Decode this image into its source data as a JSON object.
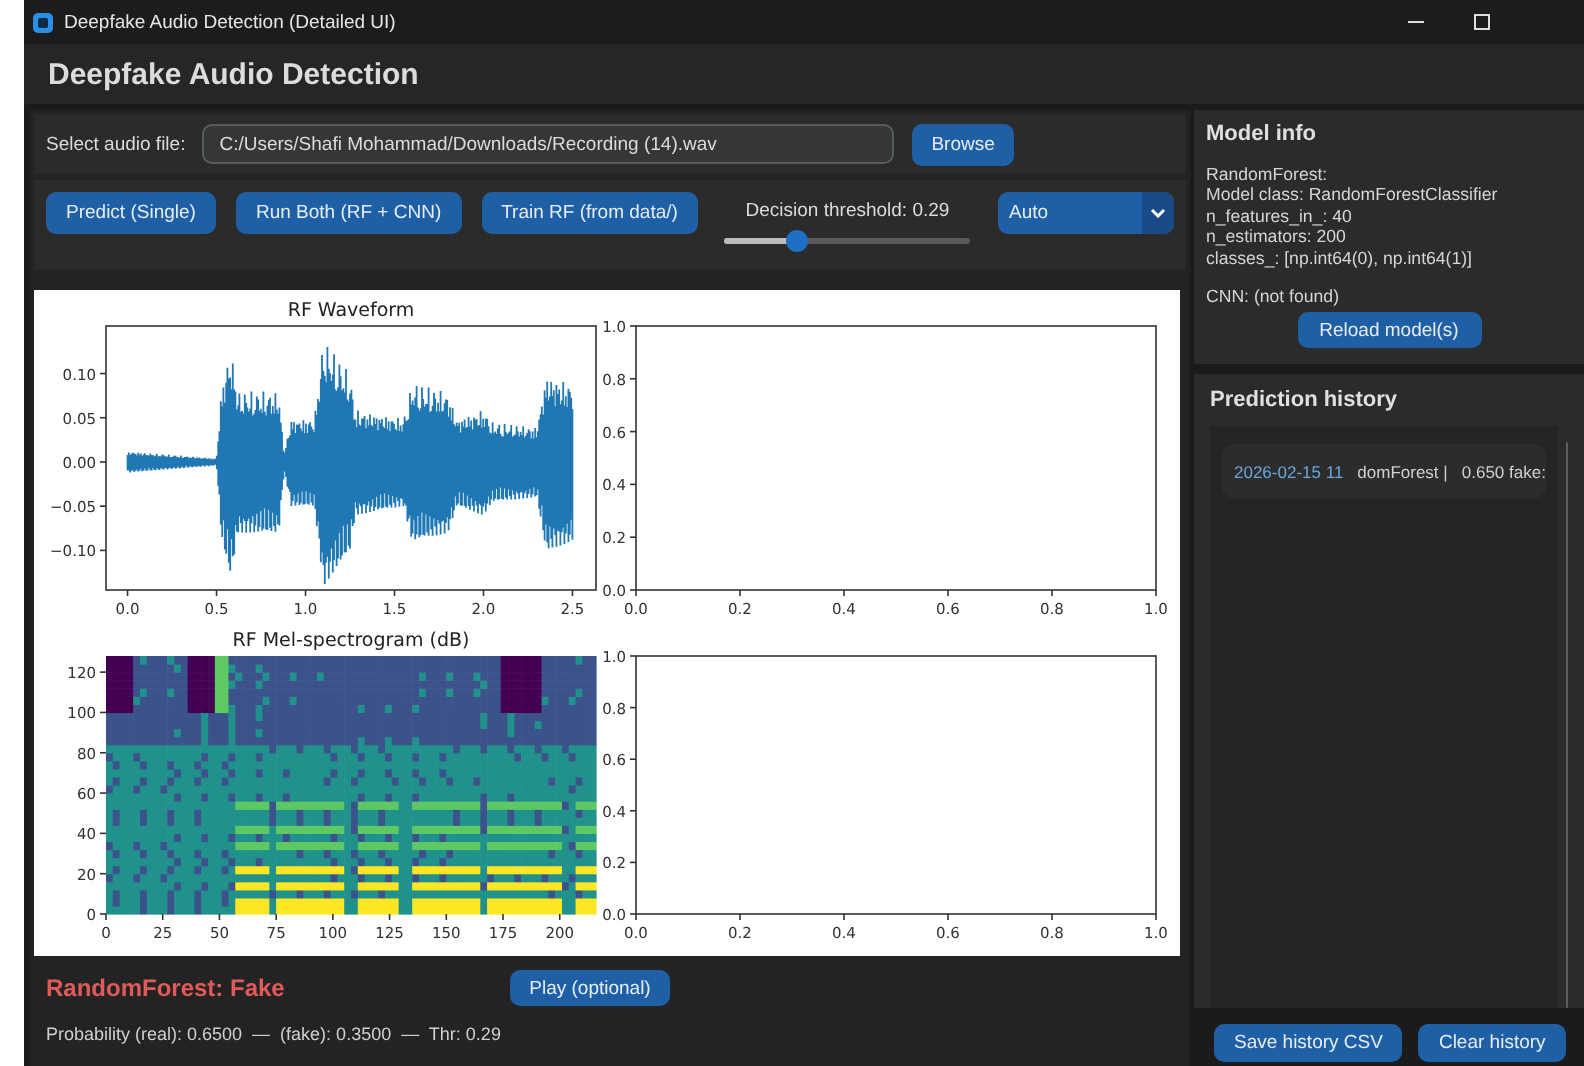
{
  "window": {
    "title": "Deepfake Audio Detection (Detailed UI)"
  },
  "header": {
    "title": "Deepfake Audio Detection"
  },
  "file_row": {
    "label": "Select audio file:",
    "value": "C:/Users/Shafi Mohammad/Downloads/Recording (14).wav",
    "button": "Browse"
  },
  "actions": [
    "Predict (Single)",
    "Run Both (RF + CNN)",
    "Train RF (from data/)"
  ],
  "threshold": {
    "label": "Decision threshold: 0.29",
    "level": 0.29
  },
  "mode_select": {
    "value": "Auto"
  },
  "plots": [
    {
      "kind": "waveform",
      "title": "RF Waveform",
      "xticks": [
        "0.0",
        "0.5",
        "1.0",
        "1.5",
        "2.0",
        "2.5"
      ],
      "yticks": [
        "0.10",
        "0.05",
        "0.00",
        "−0.05",
        "−0.10"
      ]
    },
    {
      "kind": "empty",
      "xticks": [
        "0.0",
        "0.2",
        "0.4",
        "0.6",
        "0.8",
        "1.0"
      ],
      "yticks": [
        "1.0",
        "0.8",
        "0.6",
        "0.4",
        "0.2",
        "0.0"
      ]
    },
    {
      "kind": "spectrogram",
      "title": "RF Mel-spectrogram (dB)",
      "xticks": [
        "0",
        "25",
        "50",
        "75",
        "100",
        "125",
        "150",
        "175",
        "200"
      ],
      "yticks": [
        "120",
        "100",
        "80",
        "60",
        "40",
        "20",
        "0"
      ]
    },
    {
      "kind": "empty",
      "xticks": [
        "0.0",
        "0.2",
        "0.4",
        "0.6",
        "0.8",
        "1.0"
      ],
      "yticks": [
        "1.0",
        "0.8",
        "0.6",
        "0.4",
        "0.2",
        "0.0"
      ]
    }
  ],
  "result": {
    "label": "RandomForest: Fake",
    "fake": true,
    "details": "Probability (real): 0.6500  —  (fake): 0.3500  —  Thr: 0.29",
    "play_button": "Play (optional)"
  },
  "model_info": {
    "title": "Model info",
    "lines": [
      "RandomForest:",
      "Model class: RandomForestClassifier",
      "n_features_in_: 40",
      "n_estimators: 200",
      "classes_: [np.int64(0), np.int64(1)]"
    ],
    "cnn": "CNN: (not found)",
    "button": "Reload model(s)"
  },
  "history": {
    "title": "Prediction history",
    "rows": [
      {
        "cells": [
          "2026-02-15 11",
          "domForest |",
          "0.650 fake:"
        ]
      }
    ],
    "buttons": [
      "Save history CSV",
      "Clear history"
    ]
  }
}
